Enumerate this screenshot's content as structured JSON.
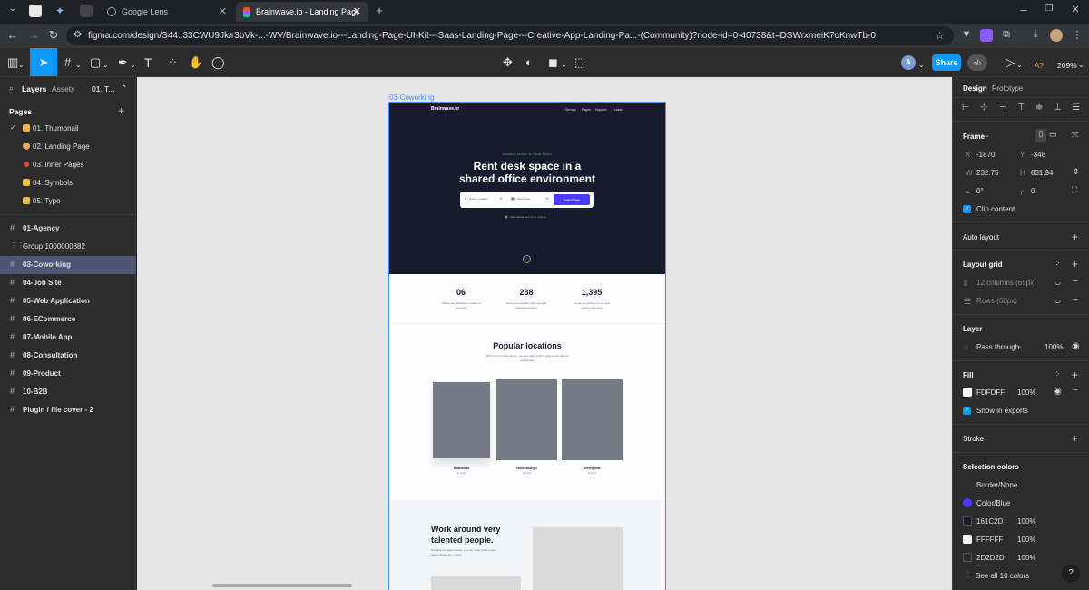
{
  "browser": {
    "tabs": [
      {
        "label": "Google Lens"
      },
      {
        "label": "Brainwave.io - Landing Page UI"
      }
    ],
    "url": "figma.com/design/S44..33CWU9Jk/r3bVk-...-WV/Brainwave.io---Landing-Page-UI-Kit---Saas-Landing-Page---Creative-App-Landing-Pa...-(Community)?node-id=0-40738&t=DSWrxmeiK7oKnwTb-0"
  },
  "toolbar": {
    "share_label": "Share",
    "zoom": "209%",
    "avatar_letter": "A",
    "ai_label": "A?"
  },
  "left_panel": {
    "tab_layers": "Layers",
    "tab_assets": "Assets",
    "page_selector": "01. T...",
    "pages_heading": "Pages",
    "pages": [
      {
        "label": "01. Thumbnail",
        "color": "#f5b73b"
      },
      {
        "label": "02. Landing Page",
        "color": "#f4a35b"
      },
      {
        "label": "03. Inner Pages",
        "color": "#e84a3c"
      },
      {
        "label": "04. Symbols",
        "color": "#f0c040"
      },
      {
        "label": "05. Typo",
        "color": "#f0c040"
      }
    ],
    "layers": [
      "01-Agency",
      "Group 1000000882",
      "03-Coworking",
      "04-Job Site",
      "05-Web Application",
      "06-ECommerce",
      "07-Mobile App",
      "08-Consultation",
      "09-Product",
      "10-B2B",
      "Plugin / file cover - 2"
    ]
  },
  "canvas": {
    "frame_label": "03-Coworking",
    "site": {
      "logo": "Brainwave.io",
      "nav": [
        "Service",
        "Pages",
        "Support",
        "Contact"
      ],
      "eyebrow": "SHARED SPACE IN YOUR TOWN",
      "headline_line1": "Rent desk space in a",
      "headline_line2": "shared office environment",
      "search_location": "Select Location",
      "search_date": "Select Date",
      "search_button": "Search Place",
      "hero_note": "Take virtual tour of our spaces",
      "stats": [
        {
          "value": "06",
          "desc": "Offices are available on different countries"
        },
        {
          "value": "238",
          "desc": "Seats are available right now with dedicated support"
        },
        {
          "value": "1,395",
          "desc": "People are joining our co-work spaces right now"
        }
      ],
      "locations_title": "Popular locations",
      "locations_sub": "With lots of unique blocks, you can easily build a page easily without any coding.",
      "locations": [
        {
          "name": "Beaumont",
          "sub": "12 desks"
        },
        {
          "name": "Holleybourgh",
          "sub": "14 desks"
        },
        {
          "name": "Jeronymite",
          "sub": "16 desks"
        }
      ],
      "people_title_line1": "Work around very",
      "people_title_line2": "talented people.",
      "people_sub": "With lots of unique blocks, you can easily build a page easily without any coding."
    }
  },
  "right_panel": {
    "tab_design": "Design",
    "tab_prototype": "Prototype",
    "frame_heading": "Frame",
    "x_label": "X",
    "x_value": "-1870",
    "y_label": "Y",
    "y_value": "-348",
    "w_label": "W",
    "w_value": "232.75",
    "h_label": "H",
    "h_value": "831.94",
    "rotation": "0°",
    "radius": "0",
    "clip_content": "Clip content",
    "auto_layout": "Auto layout",
    "layout_grid": "Layout grid",
    "grid_columns": "12 columns (65px)",
    "grid_rows": "Rows (60px)",
    "layer_heading": "Layer",
    "blend_mode": "Pass through",
    "layer_opacity": "100%",
    "fill_heading": "Fill",
    "fill_hex": "FDFDFF",
    "fill_opacity": "100%",
    "show_in_exports": "Show in exports",
    "stroke_heading": "Stroke",
    "selection_colors_heading": "Selection colors",
    "selection_colors": [
      {
        "label": "Border/None",
        "color": "",
        "opacity": ""
      },
      {
        "label": "Color/Blue",
        "color": "#4a3aff",
        "opacity": ""
      },
      {
        "label": "161C2D",
        "color": "#161c2d",
        "opacity": "100%"
      },
      {
        "label": "FFFFFF",
        "color": "#ffffff",
        "opacity": "100%"
      },
      {
        "label": "2D2D2D",
        "color": "#2d2d2d",
        "opacity": "100%"
      }
    ],
    "see_all": "See all 10 colors",
    "help": "?"
  }
}
